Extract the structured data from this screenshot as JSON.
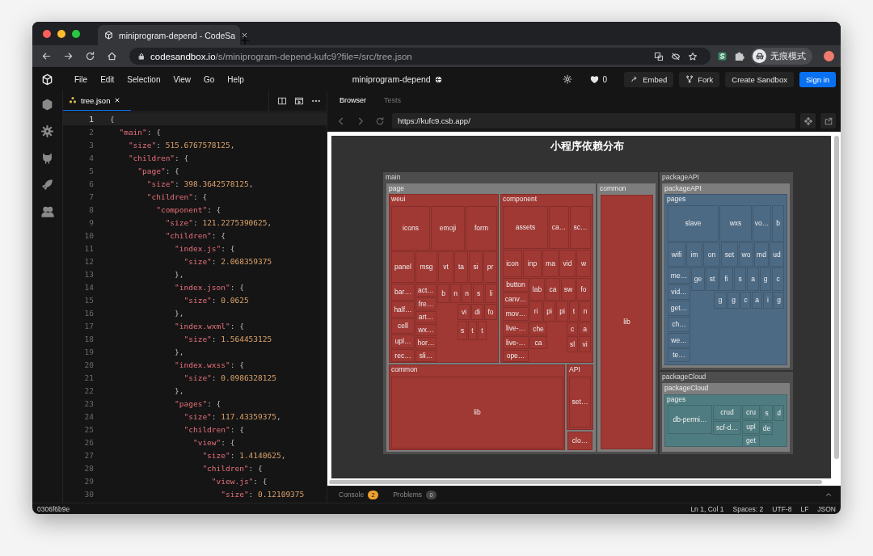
{
  "browser": {
    "tab_title": "miniprogram-depend - CodeSa",
    "url_host": "codesandbox.io",
    "url_path": "/s/miniprogram-depend-kufc9?file=/src/tree.json",
    "profile_label": "无痕模式"
  },
  "menu": [
    "File",
    "Edit",
    "Selection",
    "View",
    "Go",
    "Help"
  ],
  "sandbox_title": "miniprogram-depend",
  "likes": "0",
  "header_buttons": [
    {
      "label": "Embed",
      "kind": "share"
    },
    {
      "label": "Fork",
      "kind": "fork"
    },
    {
      "label": "Create Sandbox",
      "kind": "plain"
    },
    {
      "label": "Sign in",
      "kind": "primary"
    }
  ],
  "editor": {
    "tabs": [
      {
        "label": "tree.json",
        "selected": true
      }
    ],
    "lines": [
      {
        "number": "1",
        "text": "{",
        "active": true
      },
      {
        "number": "2",
        "text": "  \"main\": {",
        "active": false
      },
      {
        "number": "3",
        "text": "    \"size\": 515.6767578125,",
        "active": false
      },
      {
        "number": "4",
        "text": "    \"children\": {",
        "active": false
      },
      {
        "number": "5",
        "text": "      \"page\": {",
        "active": false
      },
      {
        "number": "6",
        "text": "        \"size\": 398.3642578125,",
        "active": false
      },
      {
        "number": "7",
        "text": "        \"children\": {",
        "active": false
      },
      {
        "number": "8",
        "text": "          \"component\": {",
        "active": false
      },
      {
        "number": "9",
        "text": "            \"size\": 121.2275390625,",
        "active": false
      },
      {
        "number": "10",
        "text": "            \"children\": {",
        "active": false
      },
      {
        "number": "11",
        "text": "              \"index.js\": {",
        "active": false
      },
      {
        "number": "12",
        "text": "                \"size\": 2.068359375",
        "active": false
      },
      {
        "number": "13",
        "text": "              },",
        "active": false
      },
      {
        "number": "14",
        "text": "              \"index.json\": {",
        "active": false
      },
      {
        "number": "15",
        "text": "                \"size\": 0.0625",
        "active": false
      },
      {
        "number": "16",
        "text": "              },",
        "active": false
      },
      {
        "number": "17",
        "text": "              \"index.wxml\": {",
        "active": false
      },
      {
        "number": "18",
        "text": "                \"size\": 1.564453125",
        "active": false
      },
      {
        "number": "19",
        "text": "              },",
        "active": false
      },
      {
        "number": "20",
        "text": "              \"index.wxss\": {",
        "active": false
      },
      {
        "number": "21",
        "text": "                \"size\": 0.0986328125",
        "active": false
      },
      {
        "number": "22",
        "text": "              },",
        "active": false
      },
      {
        "number": "23",
        "text": "              \"pages\": {",
        "active": false
      },
      {
        "number": "24",
        "text": "                \"size\": 117.43359375,",
        "active": false
      },
      {
        "number": "25",
        "text": "                \"children\": {",
        "active": false
      },
      {
        "number": "26",
        "text": "                  \"view\": {",
        "active": false
      },
      {
        "number": "27",
        "text": "                    \"size\": 1.4140625,",
        "active": false
      },
      {
        "number": "28",
        "text": "                    \"children\": {",
        "active": false
      },
      {
        "number": "29",
        "text": "                      \"view.js\": {",
        "active": false
      },
      {
        "number": "30",
        "text": "                        \"size\": 0.12109375",
        "active": false
      }
    ]
  },
  "preview": {
    "tabs": [
      {
        "label": "Browser",
        "selected": true
      },
      {
        "label": "Tests",
        "selected": false
      }
    ],
    "url": "https://kufc9.csb.app/",
    "chart": {
      "title": "小程序依赖分布",
      "nodes": [
        {
          "label": "main",
          "color": "#a03833",
          "children": [
            {
              "label": "page",
              "children": [
                {
                  "label": "weui",
                  "children": [
                    {
                      "label": "icons"
                    },
                    {
                      "label": "emoji"
                    },
                    {
                      "label": "form"
                    },
                    {
                      "label": "panel"
                    },
                    {
                      "label": "msg"
                    },
                    {
                      "label": "vt"
                    },
                    {
                      "label": "ta"
                    },
                    {
                      "label": "si"
                    },
                    {
                      "label": "pr"
                    },
                    {
                      "label": "bar…"
                    },
                    {
                      "label": "half…"
                    },
                    {
                      "label": "cell"
                    },
                    {
                      "label": "upl…"
                    },
                    {
                      "label": "rec…"
                    },
                    {
                      "label": "act…"
                    },
                    {
                      "label": "fre…"
                    },
                    {
                      "label": "art…"
                    },
                    {
                      "label": "wx…"
                    },
                    {
                      "label": "hor…"
                    },
                    {
                      "label": "sli…"
                    },
                    {
                      "label": "b"
                    },
                    {
                      "label": "n"
                    },
                    {
                      "label": "n"
                    },
                    {
                      "label": "s"
                    },
                    {
                      "label": "li"
                    },
                    {
                      "label": "vi"
                    },
                    {
                      "label": "di"
                    },
                    {
                      "label": "fo"
                    },
                    {
                      "label": "s"
                    },
                    {
                      "label": "t"
                    },
                    {
                      "label": "t"
                    }
                  ]
                },
                {
                  "label": "component",
                  "children": [
                    {
                      "label": "assets"
                    },
                    {
                      "label": "ca…"
                    },
                    {
                      "label": "sc…"
                    },
                    {
                      "label": "icon"
                    },
                    {
                      "label": "inp"
                    },
                    {
                      "label": "ma"
                    },
                    {
                      "label": "vid"
                    },
                    {
                      "label": "w"
                    },
                    {
                      "label": "button"
                    },
                    {
                      "label": "canv…"
                    },
                    {
                      "label": "mov…"
                    },
                    {
                      "label": "live-…"
                    },
                    {
                      "label": "live-…"
                    },
                    {
                      "label": "ope…"
                    },
                    {
                      "label": "lab"
                    },
                    {
                      "label": "ca"
                    },
                    {
                      "label": "sw"
                    },
                    {
                      "label": "fo"
                    },
                    {
                      "label": "ri"
                    },
                    {
                      "label": "pi"
                    },
                    {
                      "label": "pi"
                    },
                    {
                      "label": "t"
                    },
                    {
                      "label": "n"
                    },
                    {
                      "label": "che"
                    },
                    {
                      "label": "ca"
                    },
                    {
                      "label": "c"
                    },
                    {
                      "label": "a"
                    },
                    {
                      "label": "sl"
                    },
                    {
                      "label": "vi"
                    }
                  ]
                },
                {
                  "label": "common",
                  "children": [
                    {
                      "label": "lib"
                    }
                  ]
                },
                {
                  "label": "API",
                  "children": [
                    {
                      "label": "set…"
                    }
                  ]
                },
                {
                  "label": "clo…"
                }
              ]
            },
            {
              "label": "common",
              "children": [
                {
                  "label": "lib"
                }
              ]
            }
          ]
        },
        {
          "label": "packageAPI",
          "color": "#4d6a84",
          "children": [
            {
              "label": "packageAPI",
              "children": [
                {
                  "label": "pages",
                  "children": [
                    {
                      "label": "slave"
                    },
                    {
                      "label": "wxs"
                    },
                    {
                      "label": "vo…"
                    },
                    {
                      "label": "b"
                    },
                    {
                      "label": "wifi"
                    },
                    {
                      "label": "im"
                    },
                    {
                      "label": "on"
                    },
                    {
                      "label": "set"
                    },
                    {
                      "label": "wo"
                    },
                    {
                      "label": "md"
                    },
                    {
                      "label": "ud"
                    },
                    {
                      "label": "me…"
                    },
                    {
                      "label": "vid…"
                    },
                    {
                      "label": "get…"
                    },
                    {
                      "label": "ch…"
                    },
                    {
                      "label": "we…"
                    },
                    {
                      "label": "te…"
                    },
                    {
                      "label": "ge"
                    },
                    {
                      "label": "st"
                    },
                    {
                      "label": "fi"
                    },
                    {
                      "label": "s"
                    },
                    {
                      "label": "a"
                    },
                    {
                      "label": "g"
                    },
                    {
                      "label": "c"
                    },
                    {
                      "label": "g"
                    },
                    {
                      "label": "g"
                    },
                    {
                      "label": "c"
                    },
                    {
                      "label": "a"
                    },
                    {
                      "label": "i"
                    },
                    {
                      "label": "g"
                    }
                  ]
                }
              ]
            }
          ]
        },
        {
          "label": "packageCloud",
          "color": "#4f7c80",
          "children": [
            {
              "label": "packageCloud",
              "children": [
                {
                  "label": "pages",
                  "children": [
                    {
                      "label": "db-permi…"
                    },
                    {
                      "label": "crud"
                    },
                    {
                      "label": "scf-d…"
                    },
                    {
                      "label": "cru"
                    },
                    {
                      "label": "upl"
                    },
                    {
                      "label": "get"
                    },
                    {
                      "label": "s"
                    },
                    {
                      "label": "d"
                    },
                    {
                      "label": "de"
                    }
                  ]
                }
              ]
            }
          ]
        }
      ]
    },
    "panels": [
      {
        "label": "Console",
        "count": "2",
        "kind": "warning"
      },
      {
        "label": "Problems",
        "count": "0",
        "kind": "neutral"
      }
    ]
  },
  "status_bar": {
    "commit": "0306f6b9e",
    "items": [
      "Ln 1, Col 1",
      "Spaces: 2",
      "UTF-8",
      "LF",
      "JSON"
    ]
  }
}
